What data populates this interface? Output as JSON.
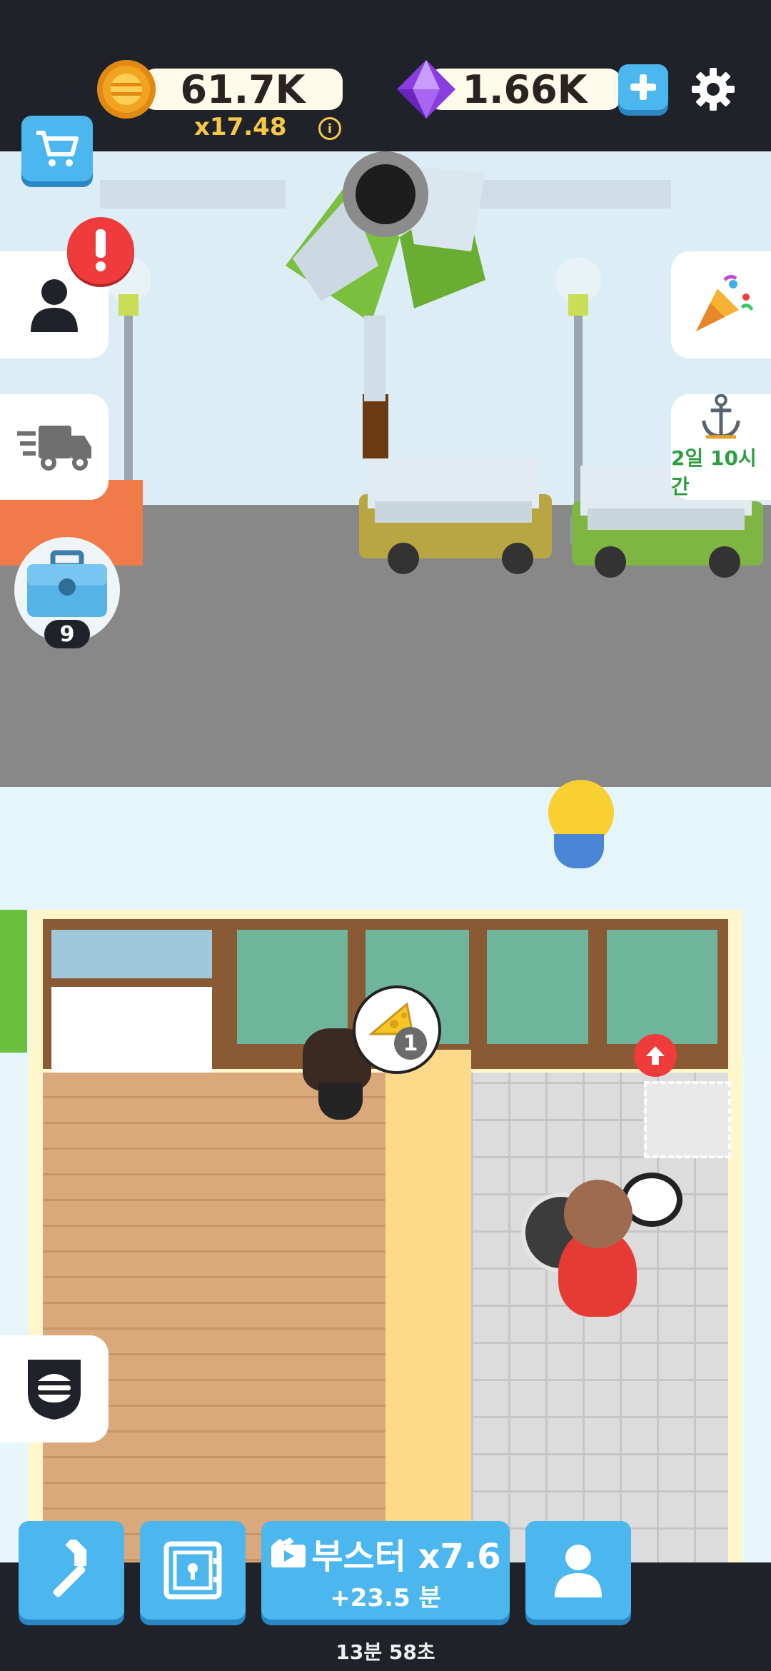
{
  "currency": {
    "coins": "61.7K",
    "multiplier": "x17.48",
    "gems": "1.66K"
  },
  "icons": {
    "coin": "coin-icon",
    "gem": "gem-icon",
    "add": "plus-icon",
    "settings": "gear-icon",
    "shop": "cart-icon",
    "profile": "person-icon",
    "alert": "exclamation-icon",
    "delivery": "truck-icon",
    "party": "party-popper-icon",
    "anchor": "anchor-icon",
    "chest": "toolbox-icon",
    "badge": "burger-shield-icon",
    "build": "hammer-icon",
    "safe": "safe-icon",
    "video": "video-icon",
    "staff": "person-icon"
  },
  "side": {
    "anchor_timer": "2일 10시간",
    "chest_count": "9"
  },
  "order": {
    "count": "1"
  },
  "bottom": {
    "booster_label": "부스터 x7.6",
    "booster_time": "+23.5 분",
    "timer": "13분 58초"
  },
  "colors": {
    "accent": "#4bb7ee",
    "alert": "#ef3b3b",
    "coin": "#f3a322",
    "gem": "#8a3ee0",
    "timer_green": "#2e9e3f"
  }
}
